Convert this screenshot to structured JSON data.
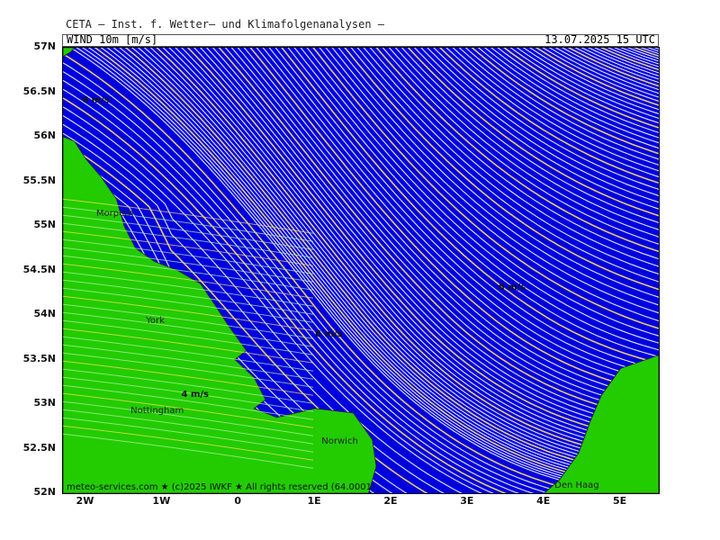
{
  "header": {
    "title": "CETA — Inst. f. Wetter— und Klimafolgenanalysen —",
    "subtitle": "WIND 10m [m/s]",
    "valid_time": "13.07.2025 15 UTC"
  },
  "axes": {
    "lat_labels": [
      "57N",
      "56.5N",
      "56N",
      "55.5N",
      "55N",
      "54.5N",
      "54N",
      "53.5N",
      "53N",
      "52.5N",
      "52N"
    ],
    "lat_values": [
      57,
      56.5,
      56,
      55.5,
      55,
      54.5,
      54,
      53.5,
      53,
      52.5,
      52
    ],
    "lon_labels": [
      "2W",
      "1W",
      "0",
      "1E",
      "2E",
      "3E",
      "4E",
      "5E"
    ],
    "lon_values": [
      -2,
      -1,
      0,
      1,
      2,
      3,
      4,
      5
    ],
    "lon_range": [
      -2.3,
      5.5
    ],
    "lat_range": [
      52,
      57
    ]
  },
  "cities": [
    {
      "name": "Morpeth",
      "lon": -1.7,
      "lat": 55.13
    },
    {
      "name": "York",
      "lon": -1.05,
      "lat": 53.93
    },
    {
      "name": "Nottingham",
      "lon": -1.25,
      "lat": 52.92
    },
    {
      "name": "Norwich",
      "lon": 1.25,
      "lat": 52.58
    },
    {
      "name": "Den Haag",
      "lon": 4.3,
      "lat": 52.08
    }
  ],
  "speed_labels": [
    {
      "text": "6 m/s",
      "lon": -2.05,
      "lat": 56.4
    },
    {
      "text": "4 m/s",
      "lon": -0.75,
      "lat": 53.1
    },
    {
      "text": "6 m/s",
      "lon": 1.0,
      "lat": 53.78
    },
    {
      "text": "6 m/s",
      "lon": 3.4,
      "lat": 54.3
    }
  ],
  "footer": {
    "credit": "meteo-services.com ★ (c)2025 IWKF ★ All rights reserved (64.0001)",
    "brand": "Den Haag"
  },
  "colors": {
    "sea": "#0000dd",
    "land": "#22cc00",
    "streamline_white": "#ffffff",
    "streamline_yellow": "#ffe066",
    "border_dark": "#222222"
  }
}
